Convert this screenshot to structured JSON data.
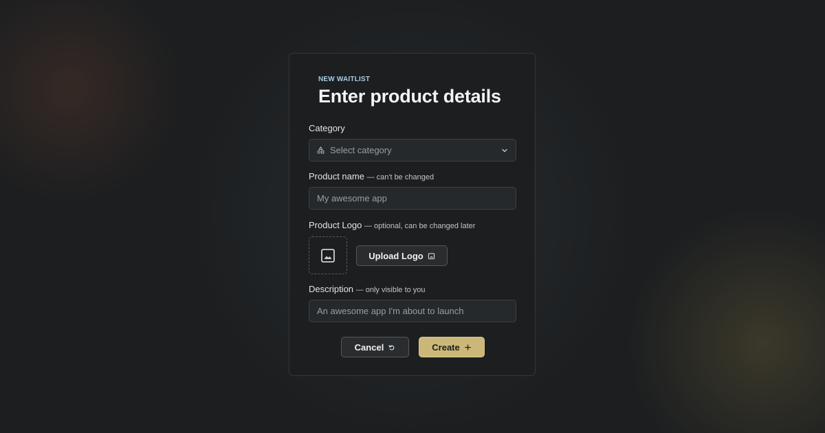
{
  "form": {
    "eyebrow": "NEW WAITLIST",
    "title": "Enter product details",
    "category": {
      "label": "Category",
      "placeholder": "Select category"
    },
    "product_name": {
      "label": "Product name",
      "hint": "— can't be changed",
      "placeholder": "My awesome app"
    },
    "product_logo": {
      "label": "Product Logo",
      "hint": "— optional, can be changed later",
      "upload_label": "Upload Logo"
    },
    "description": {
      "label": "Description",
      "hint": "— only visible to you",
      "placeholder": "An awesome app I'm about to launch"
    },
    "actions": {
      "cancel_label": "Cancel",
      "create_label": "Create"
    }
  },
  "colors": {
    "accent": "#cbb878",
    "eyebrow": "#a9cde6",
    "card_bg": "#1c1e20"
  },
  "icons": {
    "category": "shapes-icon",
    "dropdown": "chevron-down-icon",
    "logo_placeholder": "image-icon",
    "upload": "image-upload-icon",
    "cancel": "undo-icon",
    "create": "plus-icon"
  }
}
